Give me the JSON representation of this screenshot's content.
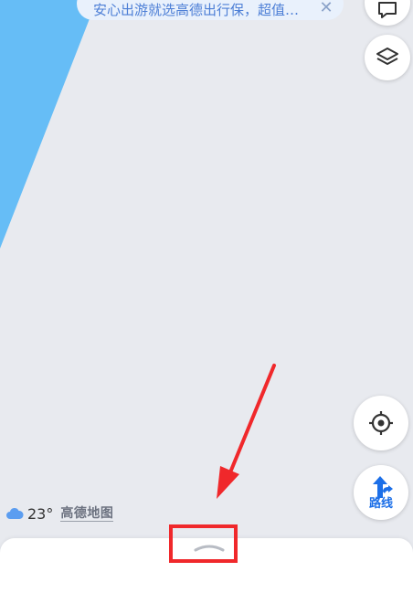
{
  "banner": {
    "text": "安心出游就选高德出行保，超值…",
    "close_icon": "close-icon"
  },
  "buttons": {
    "message_icon": "message-icon",
    "layers_icon": "layers-icon",
    "locate_icon": "locate-icon",
    "route_label": "路线",
    "route_icon": "route-arrow-icon"
  },
  "weather": {
    "icon": "cloud-icon",
    "temperature": "23°"
  },
  "brand": {
    "logo": "高德地图"
  },
  "bottom_sheet": {
    "handle_icon": "chevron-up-icon"
  },
  "annotation": {
    "color": "#f0282b"
  },
  "colors": {
    "map_background": "#e8eaef",
    "water": "#66bdf6",
    "accent": "#1c6fe8"
  }
}
